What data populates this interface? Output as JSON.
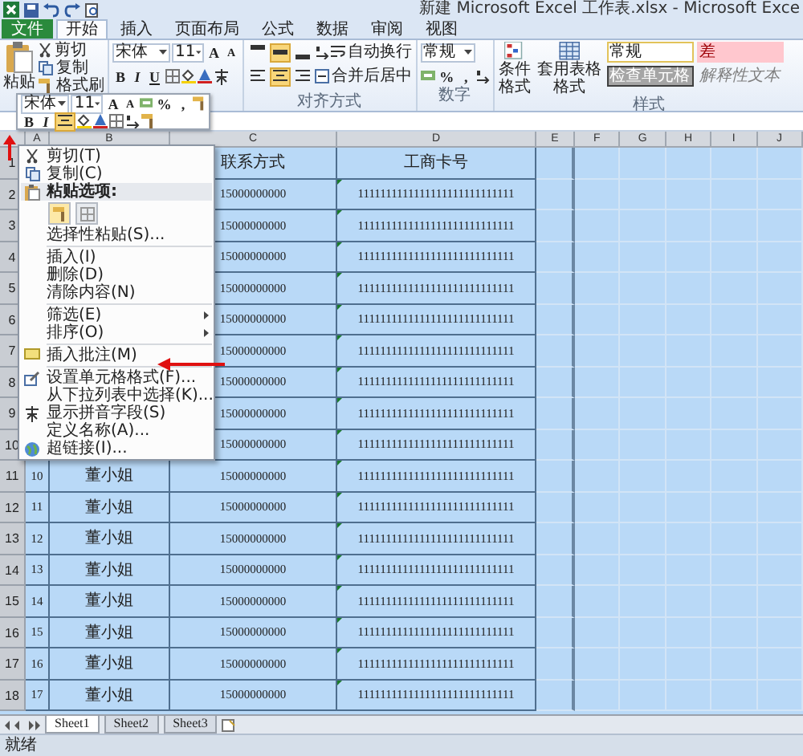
{
  "title": "新建 Microsoft Excel 工作表.xlsx - Microsoft Exce",
  "tabs": [
    {
      "label": "文件",
      "kind": "file",
      "selected": false
    },
    {
      "label": "开始",
      "kind": "tab",
      "selected": true
    },
    {
      "label": "插入",
      "kind": "tab",
      "selected": false
    },
    {
      "label": "页面布局",
      "kind": "tab",
      "selected": false
    },
    {
      "label": "公式",
      "kind": "tab",
      "selected": false
    },
    {
      "label": "数据",
      "kind": "tab",
      "selected": false
    },
    {
      "label": "审阅",
      "kind": "tab",
      "selected": false
    },
    {
      "label": "视图",
      "kind": "tab",
      "selected": false
    }
  ],
  "ribbon": {
    "clipboard": {
      "paste": "粘贴",
      "cut": "剪切",
      "copy": "复制",
      "painter": "格式刷"
    },
    "font": {
      "name": "宋体",
      "size": "11",
      "grow": "A",
      "shrink": "A",
      "bold": "B",
      "italic": "I",
      "underline": "U"
    },
    "alignment": {
      "wrap": "自动换行",
      "merge": "合并后居中",
      "label": "对齐方式",
      "vertical": [
        {
          "selected": false
        },
        {
          "selected": true
        },
        {
          "selected": false
        }
      ],
      "horizontal": [
        {
          "selected": false
        },
        {
          "selected": true
        },
        {
          "selected": false
        }
      ]
    },
    "number": {
      "format": "常规",
      "percent": "%",
      "comma": ",",
      "label": "数字"
    },
    "styles": {
      "conditional": "条件格式",
      "table": "套用表格格式",
      "label": "样式",
      "gallery": [
        {
          "label": "常规",
          "kind": "normal"
        },
        {
          "label": "差",
          "kind": "bad"
        },
        {
          "label": "检查单元格",
          "kind": "check"
        },
        {
          "label": "解释性文本",
          "kind": "explanatory"
        }
      ]
    }
  },
  "mini_toolbar": {
    "font": "宋体",
    "size": "11",
    "grow": "A",
    "shrink": "A",
    "percent": "%",
    "comma": ",",
    "bold": "B",
    "italic": "I",
    "center_selected": true
  },
  "columns": [
    "A",
    "B",
    "C",
    "D",
    "E",
    "F",
    "G",
    "H",
    "I",
    "J"
  ],
  "rows": [
    {
      "header": "1",
      "kind": "title",
      "c": "联系方式",
      "d": "工商卡号"
    },
    {
      "header": "2",
      "kind": "data",
      "c": "15000000000",
      "d": "1111111111111111111111111111"
    },
    {
      "header": "3",
      "kind": "data",
      "c": "15000000000",
      "d": "1111111111111111111111111111"
    },
    {
      "header": "4",
      "kind": "data",
      "c": "15000000000",
      "d": "1111111111111111111111111111"
    },
    {
      "header": "5",
      "kind": "data",
      "c": "15000000000",
      "d": "1111111111111111111111111111"
    },
    {
      "header": "6",
      "kind": "data",
      "c": "15000000000",
      "d": "1111111111111111111111111111"
    },
    {
      "header": "7",
      "kind": "data",
      "c": "15000000000",
      "d": "1111111111111111111111111111"
    },
    {
      "header": "8",
      "kind": "data",
      "c": "15000000000",
      "d": "1111111111111111111111111111"
    },
    {
      "header": "9",
      "kind": "data",
      "c": "15000000000",
      "d": "1111111111111111111111111111"
    },
    {
      "header": "10",
      "kind": "data",
      "c": "15000000000",
      "d": "1111111111111111111111111111"
    },
    {
      "header": "11",
      "kind": "data",
      "a": "10",
      "b": "董小姐",
      "c": "15000000000",
      "d": "1111111111111111111111111111"
    },
    {
      "header": "12",
      "kind": "data",
      "a": "11",
      "b": "董小姐",
      "c": "15000000000",
      "d": "1111111111111111111111111111"
    },
    {
      "header": "13",
      "kind": "data",
      "a": "12",
      "b": "董小姐",
      "c": "15000000000",
      "d": "1111111111111111111111111111"
    },
    {
      "header": "14",
      "kind": "data",
      "a": "13",
      "b": "董小姐",
      "c": "15000000000",
      "d": "1111111111111111111111111111"
    },
    {
      "header": "15",
      "kind": "data",
      "a": "14",
      "b": "董小姐",
      "c": "15000000000",
      "d": "1111111111111111111111111111"
    },
    {
      "header": "16",
      "kind": "data",
      "a": "15",
      "b": "董小姐",
      "c": "15000000000",
      "d": "1111111111111111111111111111"
    },
    {
      "header": "17",
      "kind": "data",
      "a": "16",
      "b": "董小姐",
      "c": "15000000000",
      "d": "1111111111111111111111111111"
    },
    {
      "header": "18",
      "kind": "data",
      "a": "17",
      "b": "董小姐",
      "c": "15000000000",
      "d": "1111111111111111111111111111"
    }
  ],
  "context_menu": [
    {
      "kind": "item",
      "label": "剪切(T)"
    },
    {
      "kind": "item",
      "label": "复制(C)"
    },
    {
      "kind": "heading",
      "label": "粘贴选项:"
    },
    {
      "kind": "paste_icons"
    },
    {
      "kind": "item",
      "label": "选择性粘贴(S)..."
    },
    {
      "kind": "separator"
    },
    {
      "kind": "item",
      "label": "插入(I)"
    },
    {
      "kind": "item",
      "label": "删除(D)"
    },
    {
      "kind": "item",
      "label": "清除内容(N)"
    },
    {
      "kind": "separator"
    },
    {
      "kind": "item",
      "label": "筛选(E)",
      "submenu": true
    },
    {
      "kind": "item",
      "label": "排序(O)",
      "submenu": true
    },
    {
      "kind": "separator"
    },
    {
      "kind": "item",
      "label": "插入批注(M)"
    },
    {
      "kind": "separator"
    },
    {
      "kind": "item",
      "label": "设置单元格格式(F)..."
    },
    {
      "kind": "item",
      "label": "从下拉列表中选择(K)..."
    },
    {
      "kind": "item",
      "label": "显示拼音字段(S)"
    },
    {
      "kind": "item",
      "label": "定义名称(A)..."
    },
    {
      "kind": "item",
      "label": "超链接(I)..."
    }
  ],
  "sheet_tabs": [
    {
      "label": "Sheet1",
      "selected": true
    },
    {
      "label": "Sheet2",
      "selected": false
    },
    {
      "label": "Sheet3",
      "selected": false
    }
  ],
  "status_bar": "就绪"
}
